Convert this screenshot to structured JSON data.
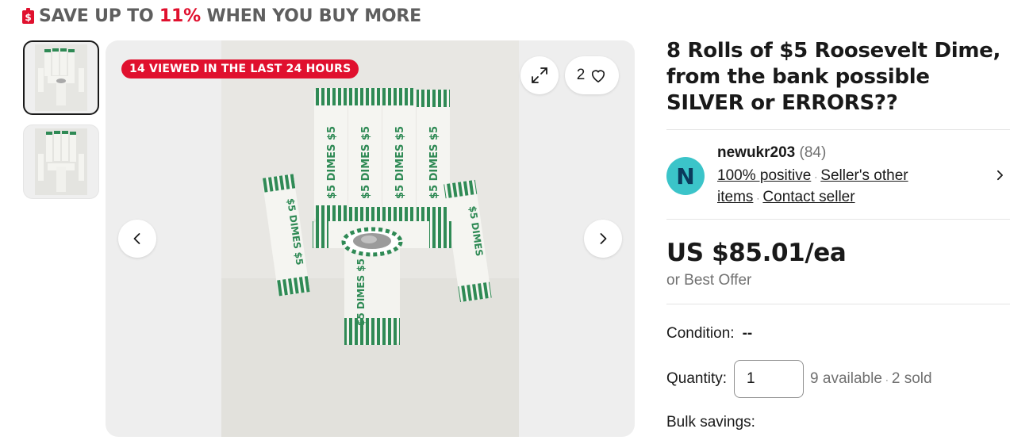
{
  "promo": {
    "prefix": "SAVE UP TO",
    "percent": "11%",
    "suffix": "WHEN YOU BUY MORE",
    "accent_color": "#e0102e"
  },
  "gallery": {
    "viewed_badge": "14 VIEWED IN THE LAST 24 HOURS",
    "watch_count": "2",
    "thumbnail_count": 2
  },
  "listing": {
    "title": "8 Rolls of $5 Roosevelt Dime, from the bank possible SILVER or ERRORS??"
  },
  "seller": {
    "initial": "N",
    "name": "newukr203",
    "feedback": "(84)",
    "positive": "100% positive",
    "other_items": "Seller's other items",
    "contact": "Contact seller",
    "avatar_color": "#3bc4c9"
  },
  "pricing": {
    "price": "US $85.01/ea",
    "best_offer": "or Best Offer"
  },
  "condition": {
    "label": "Condition:",
    "value": "--"
  },
  "quantity": {
    "label": "Quantity:",
    "value": "1",
    "available": "9 available",
    "sold": "2 sold"
  },
  "bulk": {
    "label": "Bulk savings:"
  },
  "icons": [
    "tag-icon",
    "expand-icon",
    "heart-icon",
    "chevron-left-icon",
    "chevron-right-icon"
  ]
}
